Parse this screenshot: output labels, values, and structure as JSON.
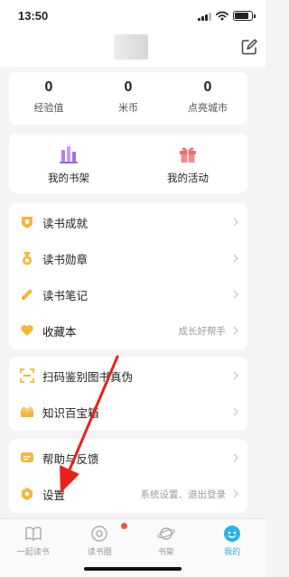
{
  "status_bar": {
    "time": "13:50",
    "battery_level": 0.85
  },
  "stats": [
    {
      "value": "0",
      "label": "经验值"
    },
    {
      "value": "0",
      "label": "米币"
    },
    {
      "value": "0",
      "label": "点亮城市"
    }
  ],
  "shortcuts": [
    {
      "label": "我的书架",
      "icon": "bookshelf-icon",
      "color": "#b57fe3"
    },
    {
      "label": "我的活动",
      "icon": "gift-icon",
      "color": "#f06a6a"
    }
  ],
  "menu_group_1": [
    {
      "label": "读书成就",
      "icon": "achievement-icon",
      "hint": ""
    },
    {
      "label": "读书勋章",
      "icon": "medal-icon",
      "hint": ""
    },
    {
      "label": "读书笔记",
      "icon": "pencil-icon",
      "hint": ""
    },
    {
      "label": "收藏本",
      "icon": "heart-icon",
      "hint": "成长好帮手"
    }
  ],
  "menu_group_2": [
    {
      "label": "扫码鉴别图书真伪",
      "icon": "scan-icon",
      "hint": ""
    },
    {
      "label": "知识百宝箱",
      "icon": "treasure-box-icon",
      "hint": ""
    }
  ],
  "menu_group_3": [
    {
      "label": "帮助与反馈",
      "icon": "feedback-icon",
      "hint": ""
    },
    {
      "label": "设置",
      "icon": "settings-icon",
      "hint": "系统设置、退出登录"
    }
  ],
  "tabs": [
    {
      "label": "一起读书",
      "icon": "book-icon",
      "active": false
    },
    {
      "label": "读书圈",
      "icon": "circle-icon",
      "active": false,
      "badge": true
    },
    {
      "label": "书架",
      "icon": "planet-icon",
      "active": false
    },
    {
      "label": "我的",
      "icon": "profile-icon",
      "active": true
    }
  ],
  "colors": {
    "accent": "#2ab3e6",
    "icon_orange": "#f5b63a",
    "arrow_red": "#e8221b"
  }
}
